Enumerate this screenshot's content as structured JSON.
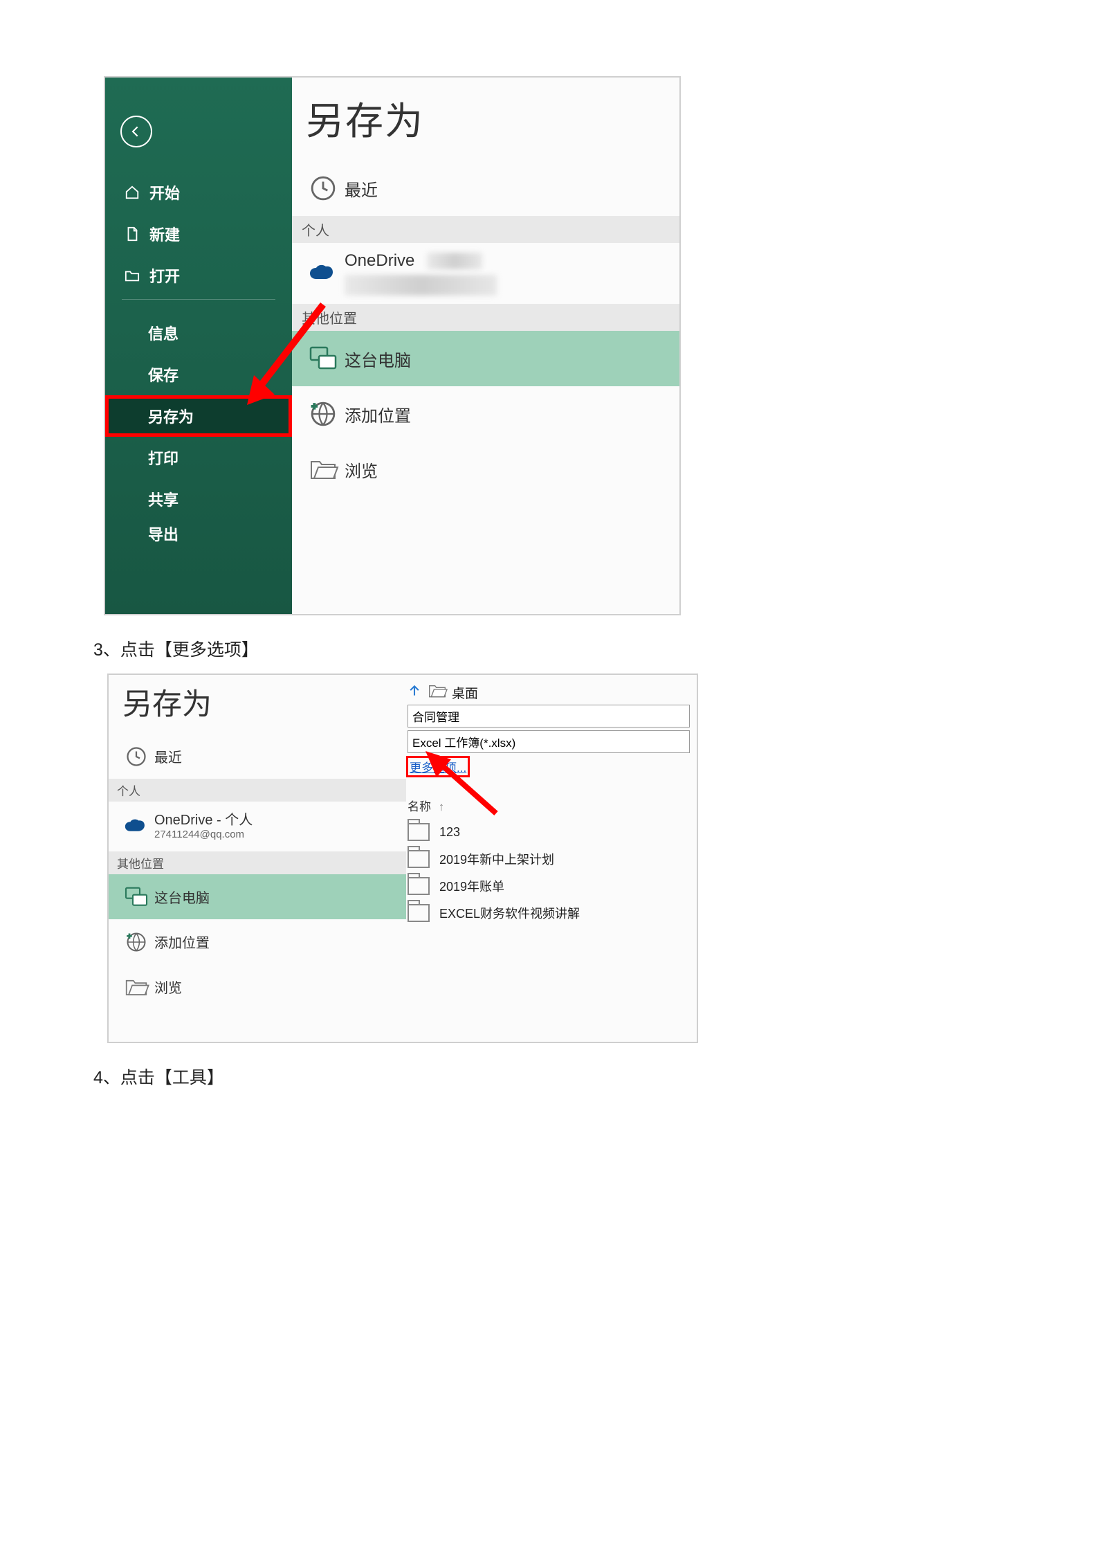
{
  "shot1": {
    "title": "另存为",
    "sidebar": {
      "items": [
        {
          "label": "开始",
          "icon": "home-icon"
        },
        {
          "label": "新建",
          "icon": "new-doc-icon"
        },
        {
          "label": "打开",
          "icon": "open-folder-icon"
        },
        {
          "label": "信息"
        },
        {
          "label": "保存"
        },
        {
          "label": "另存为",
          "selected": true
        },
        {
          "label": "打印"
        },
        {
          "label": "共享"
        },
        {
          "label": "导出"
        }
      ]
    },
    "locations": {
      "recent": "最近",
      "section_personal": "个人",
      "onedrive_prefix": "OneDrive",
      "section_other": "其他位置",
      "this_pc": "这台电脑",
      "add_location": "添加位置",
      "browse": "浏览"
    }
  },
  "caption3": "3、点击【更多选项】",
  "shot2": {
    "title": "另存为",
    "locations": {
      "recent": "最近",
      "section_personal": "个人",
      "onedrive_line1": "OneDrive - 个人",
      "onedrive_line2": "27411244@qq.com",
      "section_other": "其他位置",
      "this_pc": "这台电脑",
      "add_location": "添加位置",
      "browse": "浏览"
    },
    "right": {
      "breadcrumb": "桌面",
      "filename": "合同管理",
      "filetype": "Excel 工作簿(*.xlsx)",
      "more_options": "更多选项...",
      "col_name": "名称",
      "files": [
        {
          "name": "123"
        },
        {
          "name": "2019年新中上架计划"
        },
        {
          "name": "2019年账单"
        },
        {
          "name": "EXCEL财务软件视频讲解"
        }
      ]
    }
  },
  "caption4": "4、点击【工具】"
}
